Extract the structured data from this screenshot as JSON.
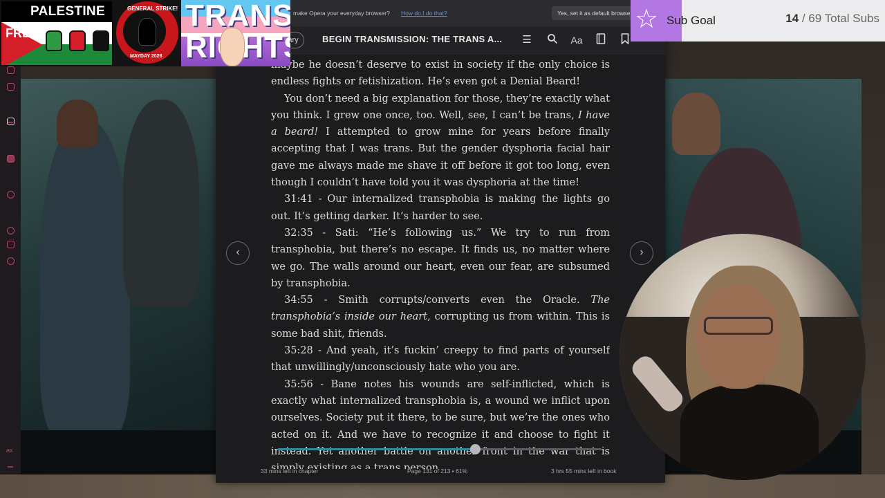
{
  "overlays": {
    "palestine": {
      "title": "PALESTINE",
      "free": "FREE"
    },
    "strike": {
      "top": "GENERAL STRIKE!",
      "bottom": "MAYDAY 2028"
    },
    "trans": {
      "line1": "TRANS",
      "line2": "RIGHTS"
    }
  },
  "opera_bar": {
    "message": "make Opera your everyday browser?",
    "link": "How do I do that?",
    "button": "Yes, set it as default browser"
  },
  "sub_goal": {
    "label": "Sub Goal",
    "current": "14",
    "rest": "/ 69 Total Subs"
  },
  "reader": {
    "library_label": "ary",
    "book_title": "BEGIN TRANSMISSION: THE TRANS A...",
    "toolbar_icons": [
      "toc-icon",
      "search-icon",
      "font-icon",
      "notebook-icon",
      "bookmark-icon"
    ],
    "paragraphs": {
      "p1": "maybe he doesn’t deserve to exist in society if the only choice is endless fights or fetishization. He’s even got a Denial Beard!",
      "p2a": "You don’t need a big explanation for those, they’re exactly what you think. I grew one once, too. Well, see, I can’t be trans, ",
      "p2em": "I have a beard!",
      "p2b": " I attempted to grow mine for years before finally accepting that I was trans. But the gender dysphoria facial hair gave me always made me shave it off before it got too long, even though I couldn’t have told you it was dysphoria at the time!",
      "p3": "31:41 - Our internalized transphobia is making the lights go out. It’s getting darker. It’s harder to see.",
      "p4": "32:35 - Sati: “He’s following us.” We try to run from transphobia, but there’s no escape. It finds us, no matter where we go. The walls around our heart, even our fear, are subsumed by transphobia.",
      "p5a": "34:55 - Smith corrupts/converts even the Oracle. ",
      "p5em": "The transphobia’s inside our heart",
      "p5b": ", corrupting us from within. This is some bad shit, friends.",
      "p6": "35:28 - And yeah, it’s fuckin’ creepy to find parts of yourself that unwillingly/unconsciously hate who you are.",
      "p7": "35:56 - Bane notes his wounds are self-inflicted, which is exactly what internalized transphobia is, a wound we inflict upon ourselves. Society put it there, to be sure, but we’re the ones who acted on it. And we have to recognize it and choose to fight it instead. Yet another battle on another front in the war that is simply existing as a trans person."
    },
    "progress_percent": 61,
    "footer": {
      "chapter_left": "33 mins left in chapter",
      "page": "Page 131 of 213",
      "percent": "61%",
      "book_left": "3 hrs 55 mins left in book"
    },
    "prev_label": "‹",
    "next_label": "›"
  },
  "sidebar_strip": {
    "bottom_label": "ax"
  },
  "colors": {
    "accent": "#2f8a9e",
    "subgoal": "#b277e3"
  }
}
